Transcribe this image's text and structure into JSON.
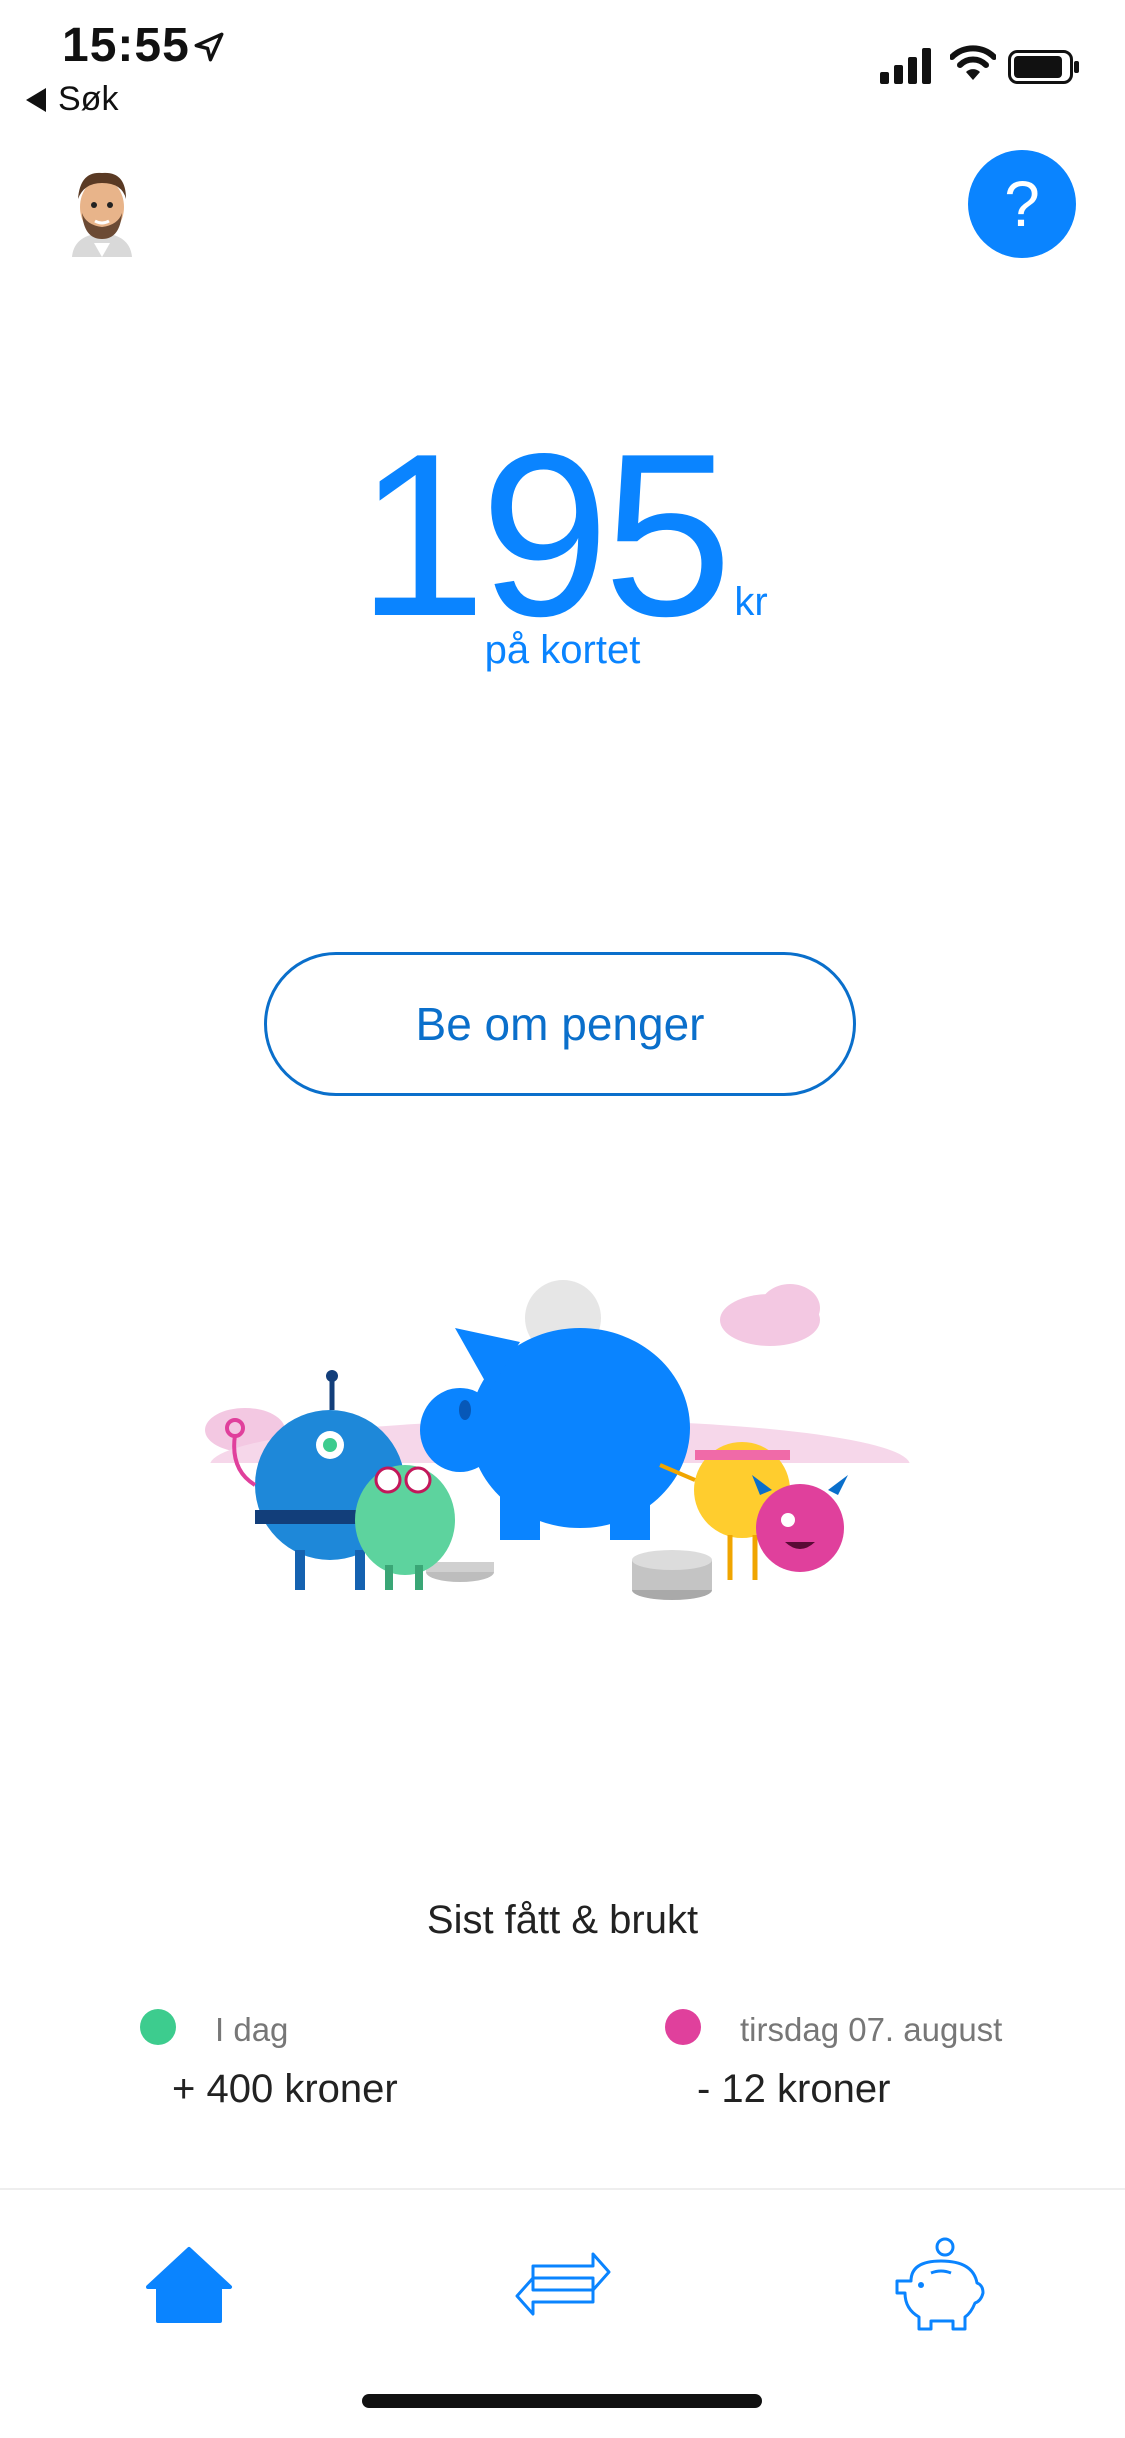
{
  "status_bar": {
    "time": "15:55",
    "back_label": "Søk"
  },
  "header": {
    "help_label": "?"
  },
  "balance": {
    "amount": "195",
    "unit": "kr",
    "label": "på kortet"
  },
  "actions": {
    "request_money_label": "Be om penger"
  },
  "recent": {
    "title": "Sist fått & brukt",
    "items": [
      {
        "date": "I dag",
        "amount": "+ 400 kroner",
        "color": "#3dcc8e"
      },
      {
        "date": "tirsdag 07. august",
        "amount": "-  12 kroner",
        "color": "#e0409c"
      }
    ]
  },
  "tabs": [
    {
      "name": "home",
      "icon": "home-icon",
      "active": true
    },
    {
      "name": "transfers",
      "icon": "transfer-arrows-icon",
      "active": false
    },
    {
      "name": "savings",
      "icon": "piggy-bank-icon",
      "active": false
    }
  ],
  "colors": {
    "accent": "#0a84ff",
    "button_border": "#0a6fcb"
  }
}
